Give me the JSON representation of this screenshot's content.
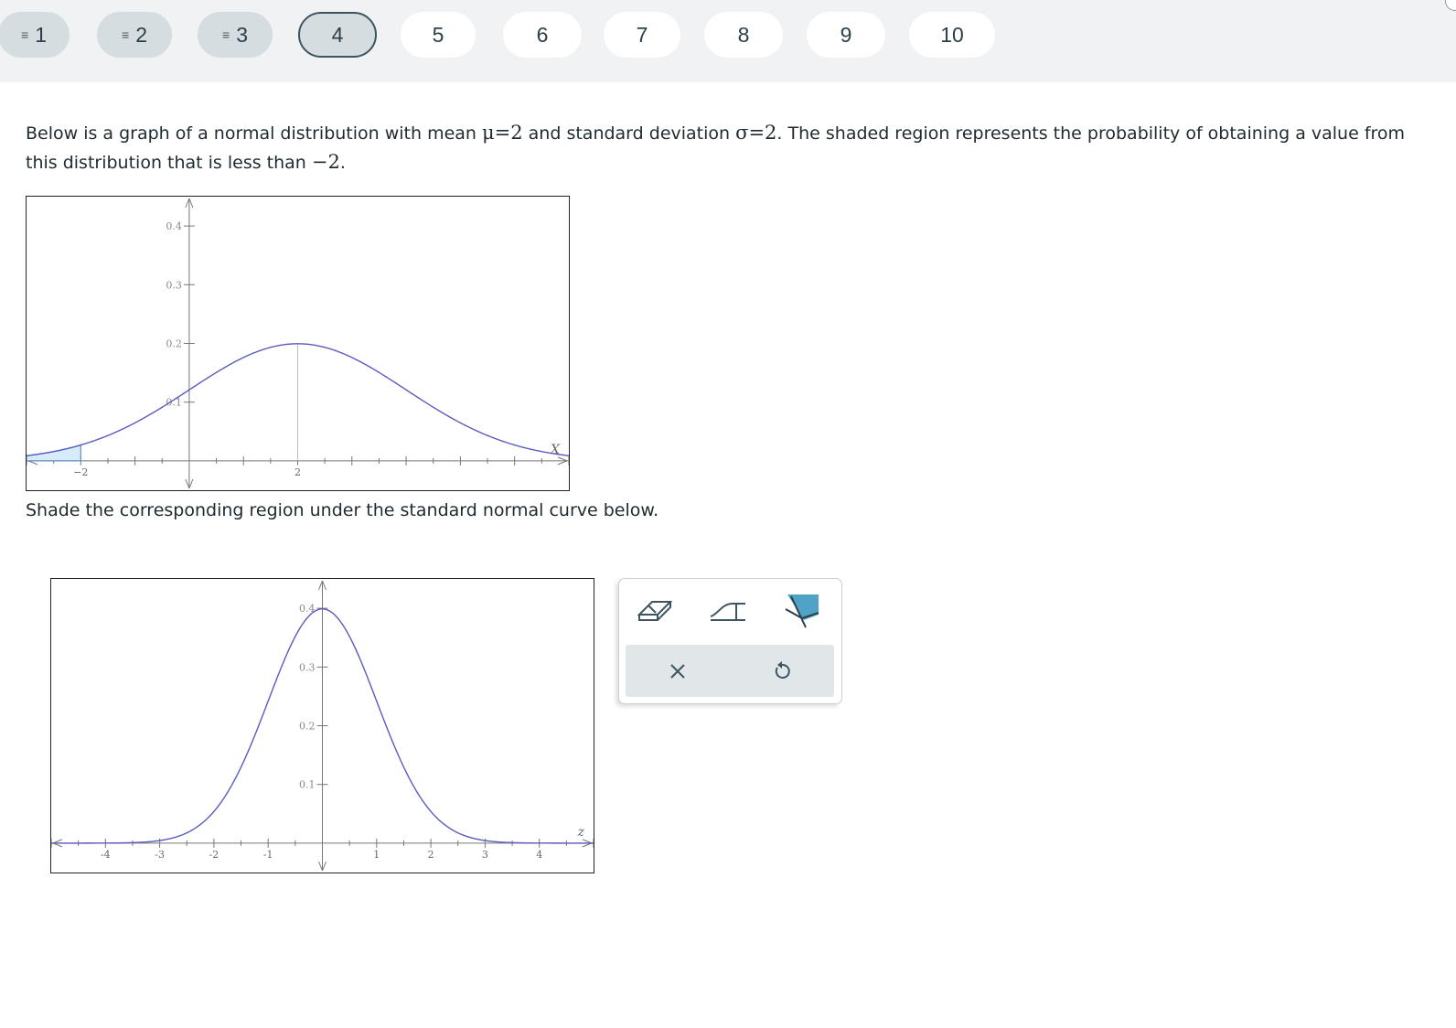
{
  "questions": [
    {
      "num": "1",
      "state": "answered"
    },
    {
      "num": "2",
      "state": "answered"
    },
    {
      "num": "3",
      "state": "answered"
    },
    {
      "num": "4",
      "state": "current"
    },
    {
      "num": "5",
      "state": "visited"
    },
    {
      "num": "6",
      "state": "unvisited"
    },
    {
      "num": "7",
      "state": "unvisited"
    },
    {
      "num": "8",
      "state": "unvisited"
    },
    {
      "num": "9",
      "state": "unvisited"
    },
    {
      "num": "10",
      "state": "unvisited"
    }
  ],
  "prompt": {
    "part1": "Below is a graph of a normal distribution with mean ",
    "mu": "μ=2",
    "part2": " and standard deviation ",
    "sigma": "σ=2",
    "part3": ". The shaded region represents the probability of obtaining a value from this distribution that is less than ",
    "value": "−2",
    "part4": "."
  },
  "instruction": "Shade the corresponding region under the standard normal curve below.",
  "chart_data": [
    {
      "type": "line",
      "mean": 2,
      "sd": 2,
      "shade_below": -2,
      "xlim": [
        -3,
        7
      ],
      "ylim": [
        -0.05,
        0.45
      ],
      "xaxis_label": "X",
      "x_tick_labels": [
        {
          "x": -2,
          "label": "−2"
        },
        {
          "x": 2,
          "label": "2"
        }
      ],
      "y_ticks": [
        0.1,
        0.2,
        0.3,
        0.4
      ],
      "y_tick_labels": [
        "0.1",
        "0.2",
        "0.3",
        "0.4"
      ],
      "colors": {
        "curve": "#5b5bbf",
        "shade": "#d6ecfa",
        "shade_edge": "#5b8fc9"
      }
    },
    {
      "type": "line",
      "mean": 0,
      "sd": 1,
      "xlim": [
        -5,
        5
      ],
      "ylim": [
        -0.05,
        0.45
      ],
      "xaxis_label": "z",
      "x_tick_labels": [
        {
          "x": -4,
          "label": "-4"
        },
        {
          "x": -3,
          "label": "-3"
        },
        {
          "x": -2,
          "label": "-2"
        },
        {
          "x": -1,
          "label": "-1"
        },
        {
          "x": 1,
          "label": "1"
        },
        {
          "x": 2,
          "label": "2"
        },
        {
          "x": 3,
          "label": "3"
        },
        {
          "x": 4,
          "label": "4"
        }
      ],
      "y_ticks": [
        0.1,
        0.2,
        0.3,
        0.4
      ],
      "y_tick_labels": [
        "0.1",
        "0.2",
        "0.3",
        "0.4"
      ],
      "colors": {
        "curve": "#5b5bbf"
      }
    }
  ],
  "tools": [
    {
      "name": "eraser-icon"
    },
    {
      "name": "threshold-line-icon"
    },
    {
      "name": "shade-region-icon",
      "color": "#4fa3c7"
    }
  ],
  "actions": [
    {
      "name": "clear-icon"
    },
    {
      "name": "undo-icon"
    }
  ]
}
